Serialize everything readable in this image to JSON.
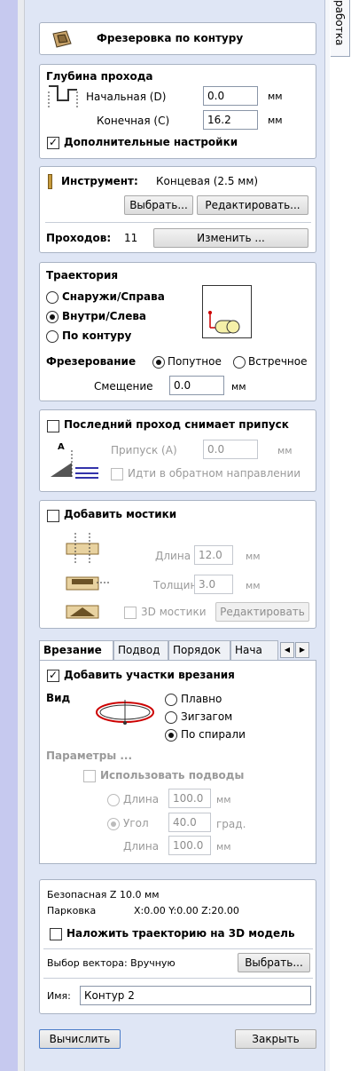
{
  "side_tab": "работка",
  "header": {
    "title": "Фрезеровка по контуру",
    "icon": "profile-toolpath-icon"
  },
  "depth": {
    "title": "Глубина прохода",
    "start_label": "Начальная (D)",
    "start_value": "0.0",
    "start_unit": "мм",
    "end_label": "Конечная (C)",
    "end_value": "16.2",
    "end_unit": "мм",
    "advanced_label": "Дополнительные настройки",
    "advanced_checked": "✓"
  },
  "tool": {
    "label": "Инструмент:",
    "name": "Концевая (2.5 мм)",
    "select_button": "Выбрать...",
    "edit_button": "Редактировать...",
    "passes_label": "Проходов:",
    "passes_value": "11",
    "change_button": "Изменить ..."
  },
  "trajectory": {
    "title": "Траектория",
    "options": [
      "Снаружи/Справа",
      "Внутри/Слева",
      "По контуру"
    ],
    "selected": "Внутри/Слева",
    "milling_label": "Фрезерование",
    "climb": "Попутное",
    "conventional": "Встречное",
    "offset_label": "Смещение",
    "offset_value": "0.0",
    "offset_unit": "мм"
  },
  "last_pass": {
    "label": "Последний проход снимает припуск",
    "allowance_label": "Припуск (A)",
    "allowance_value": "0.0",
    "allowance_unit": "мм",
    "reverse_label": "Идти в обратном направлении",
    "diagram_letter": "A"
  },
  "tabs_bridges": {
    "label": "Добавить мостики",
    "length_label": "Длина",
    "length_value": "12.0",
    "length_unit": "мм",
    "thickness_label": "Толщина",
    "thickness_value": "3.0",
    "thickness_unit": "мм",
    "bridges_3d_label": "3D мостики",
    "edit_button": "Редактировать"
  },
  "tabs": {
    "items": [
      "Врезание",
      "Подвод",
      "Порядок",
      "Нача"
    ],
    "active": "Врезание"
  },
  "ramp": {
    "add_label": "Добавить участки врезания",
    "add_checked": "✓",
    "view_label": "Вид",
    "smooth": "Плавно",
    "zigzag": "Зигзагом",
    "spiral": "По спирали",
    "params_label": "Параметры ...",
    "use_leadins": "Использовать подводы",
    "length_label": "Длина",
    "length_value": "100.0",
    "length_unit": "мм",
    "angle_label": "Угол",
    "angle_value": "40.0",
    "angle_unit": "град.",
    "length2_label": "Длина",
    "length2_value": "100.0",
    "length2_unit": "мм"
  },
  "bottom": {
    "safe_z_label": "Безопасная Z",
    "safe_z_value": "10.0 мм",
    "park_label": "Парковка",
    "park_value": "X:0.00 Y:0.00 Z:20.00",
    "project_label": "Наложить траекторию на 3D модель",
    "vector_label": "Выбор вектора: Вручную",
    "vector_button": "Выбрать...",
    "name_label": "Имя:",
    "name_value": "Контур 2"
  },
  "footer": {
    "calculate": "Вычислить",
    "close": "Закрыть"
  },
  "colors": {
    "panel_bg": "#dfe6f5",
    "left_strip": "#c6c9ef"
  }
}
